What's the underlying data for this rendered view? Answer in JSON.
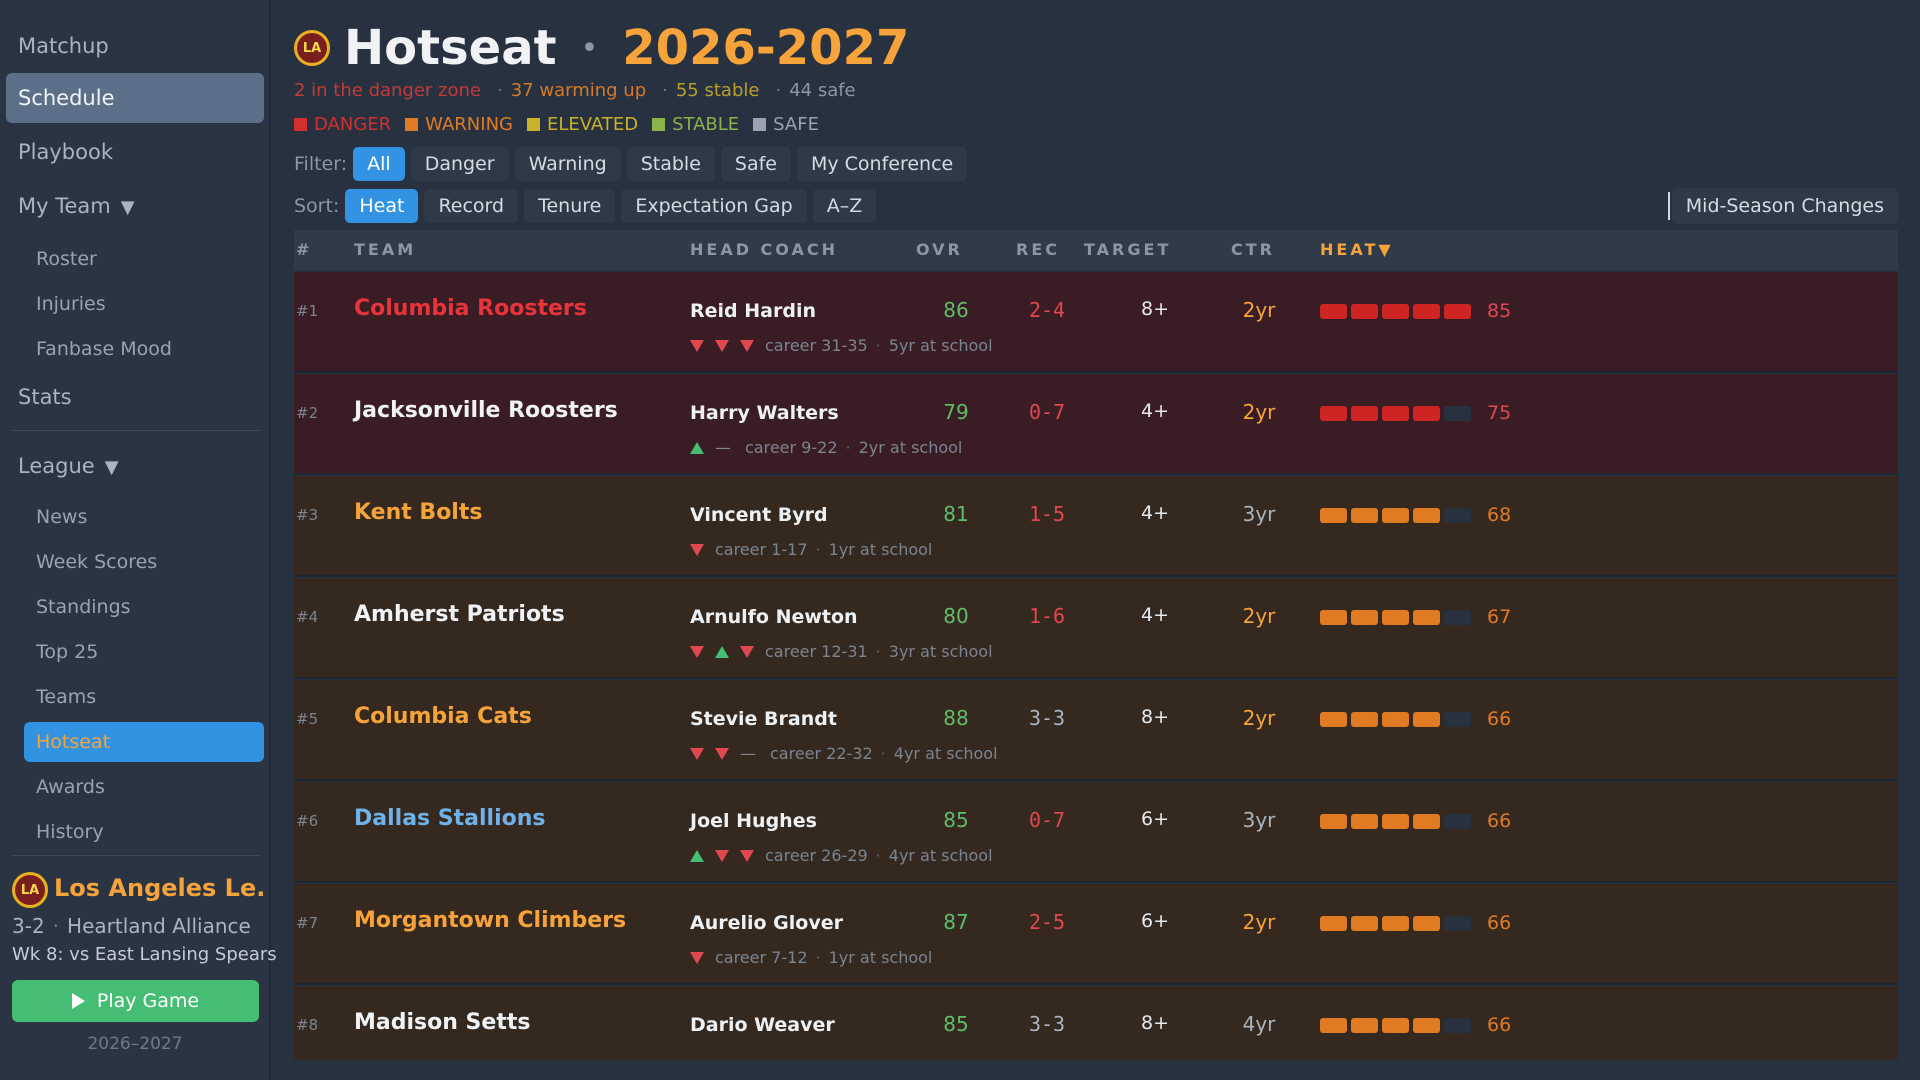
{
  "sidebar": {
    "nav": [
      {
        "label": "Matchup"
      },
      {
        "label": "Schedule"
      },
      {
        "label": "Playbook"
      },
      {
        "label": "My Team"
      }
    ],
    "my_team_items": [
      "Roster",
      "Injuries",
      "Fanbase Mood"
    ],
    "stats_label": "Stats",
    "league_label": "League",
    "league_items": [
      "News",
      "Week Scores",
      "Standings",
      "Top 25",
      "Teams",
      "Hotseat",
      "Awards",
      "History"
    ],
    "team_card": {
      "logo_text": "LA",
      "name": "Los Angeles Le...",
      "record": "3-2",
      "conference": "Heartland Alliance",
      "next_game": "Wk 8: vs East Lansing Spears"
    },
    "play_button": "Play Game",
    "season_footer": "2026–2027"
  },
  "header": {
    "logo_text": "LA",
    "title": "Hotseat",
    "dot": "•",
    "season": "2026-2027"
  },
  "summary": {
    "danger": "2 in the danger zone",
    "warming": "37 warming up",
    "stable": "55 stable",
    "safe": "44 safe",
    "sep": "·"
  },
  "legend": [
    {
      "label": "DANGER",
      "color": "#d32f2f"
    },
    {
      "label": "WARNING",
      "color": "#e07b24"
    },
    {
      "label": "ELEVATED",
      "color": "#c8b22a"
    },
    {
      "label": "STABLE",
      "color": "#8ab34a"
    },
    {
      "label": "SAFE",
      "color": "#9aa3ae"
    }
  ],
  "filter": {
    "label": "Filter:",
    "options": [
      "All",
      "Danger",
      "Warning",
      "Stable",
      "Safe",
      "My Conference"
    ],
    "active": "All"
  },
  "sort": {
    "label": "Sort:",
    "options": [
      "Heat",
      "Record",
      "Tenure",
      "Expectation Gap",
      "A–Z"
    ],
    "active": "Heat"
  },
  "mid_season_button": "Mid-Season Changes",
  "table": {
    "headers": {
      "rank": "#",
      "team": "TEAM",
      "coach": "HEAD COACH",
      "ovr": "OVR",
      "rec": "REC",
      "target": "TARGET",
      "ctr": "CTR",
      "heat": "HEAT▼"
    },
    "rows": [
      {
        "rank": "#1",
        "team": "Columbia Roosters",
        "team_color": "#e8333a",
        "coach": "Reid Hardin",
        "trend": [
          "down",
          "down",
          "down"
        ],
        "career": "career 31-35",
        "tenure": "5yr at school",
        "ovr": "86",
        "rec": "2-4",
        "rec_color": "#e1474e",
        "target": "8+",
        "ctr": "2yr",
        "ctr_color": "#f5a33a",
        "heat": 85,
        "heat_segs": 5,
        "heat_color": "#cf2424",
        "heat_text_color": "#e1474e",
        "tier": "danger"
      },
      {
        "rank": "#2",
        "team": "Jacksonville Roosters",
        "team_color": "#f0f2f5",
        "coach": "Harry Walters",
        "trend": [
          "up",
          "flat"
        ],
        "career": "career 9-22",
        "tenure": "2yr at school",
        "ovr": "79",
        "rec": "0-7",
        "rec_color": "#e1474e",
        "target": "4+",
        "ctr": "2yr",
        "ctr_color": "#f5a33a",
        "heat": 75,
        "heat_segs": 4,
        "heat_color": "#cf2424",
        "heat_text_color": "#e1474e",
        "tier": "danger"
      },
      {
        "rank": "#3",
        "team": "Kent Bolts",
        "team_color": "#f5a33a",
        "coach": "Vincent Byrd",
        "trend": [
          "down"
        ],
        "career": "career 1-17",
        "tenure": "1yr at school",
        "ovr": "81",
        "rec": "1-5",
        "rec_color": "#e1474e",
        "target": "4+",
        "ctr": "3yr",
        "ctr_color": "#aab3bf",
        "heat": 68,
        "heat_segs": 4,
        "heat_color": "#e07b24",
        "heat_text_color": "#e07b24",
        "tier": "warning"
      },
      {
        "rank": "#4",
        "team": "Amherst Patriots",
        "team_color": "#f0f2f5",
        "coach": "Arnulfo Newton",
        "trend": [
          "down",
          "up",
          "down"
        ],
        "career": "career 12-31",
        "tenure": "3yr at school",
        "ovr": "80",
        "rec": "1-6",
        "rec_color": "#e1474e",
        "target": "4+",
        "ctr": "2yr",
        "ctr_color": "#f5a33a",
        "heat": 67,
        "heat_segs": 4,
        "heat_color": "#e07b24",
        "heat_text_color": "#e07b24",
        "tier": "warning"
      },
      {
        "rank": "#5",
        "team": "Columbia Cats",
        "team_color": "#f5a33a",
        "coach": "Stevie Brandt",
        "trend": [
          "down",
          "down",
          "flat"
        ],
        "career": "career 22-32",
        "tenure": "4yr at school",
        "ovr": "88",
        "rec": "3-3",
        "rec_color": "#aab3bf",
        "target": "8+",
        "ctr": "2yr",
        "ctr_color": "#f5a33a",
        "heat": 66,
        "heat_segs": 4,
        "heat_color": "#e07b24",
        "heat_text_color": "#e07b24",
        "tier": "warning"
      },
      {
        "rank": "#6",
        "team": "Dallas Stallions",
        "team_color": "#6fb1e8",
        "coach": "Joel Hughes",
        "trend": [
          "up",
          "down",
          "down"
        ],
        "career": "career 26-29",
        "tenure": "4yr at school",
        "ovr": "85",
        "rec": "0-7",
        "rec_color": "#e1474e",
        "target": "6+",
        "ctr": "3yr",
        "ctr_color": "#aab3bf",
        "heat": 66,
        "heat_segs": 4,
        "heat_color": "#e07b24",
        "heat_text_color": "#e07b24",
        "tier": "warning"
      },
      {
        "rank": "#7",
        "team": "Morgantown Climbers",
        "team_color": "#f5a33a",
        "coach": "Aurelio Glover",
        "trend": [
          "down"
        ],
        "career": "career 7-12",
        "tenure": "1yr at school",
        "ovr": "87",
        "rec": "2-5",
        "rec_color": "#e1474e",
        "target": "6+",
        "ctr": "2yr",
        "ctr_color": "#f5a33a",
        "heat": 66,
        "heat_segs": 4,
        "heat_color": "#e07b24",
        "heat_text_color": "#e07b24",
        "tier": "warning"
      },
      {
        "rank": "#8",
        "team": "Madison Setts",
        "team_color": "#f0f2f5",
        "coach": "Dario Weaver",
        "trend": [],
        "career": "",
        "tenure": "",
        "ovr": "85",
        "rec": "3-3",
        "rec_color": "#aab3bf",
        "target": "8+",
        "ctr": "4yr",
        "ctr_color": "#aab3bf",
        "heat": 66,
        "heat_segs": 4,
        "heat_color": "#e07b24",
        "heat_text_color": "#e07b24",
        "tier": "warning"
      }
    ]
  }
}
